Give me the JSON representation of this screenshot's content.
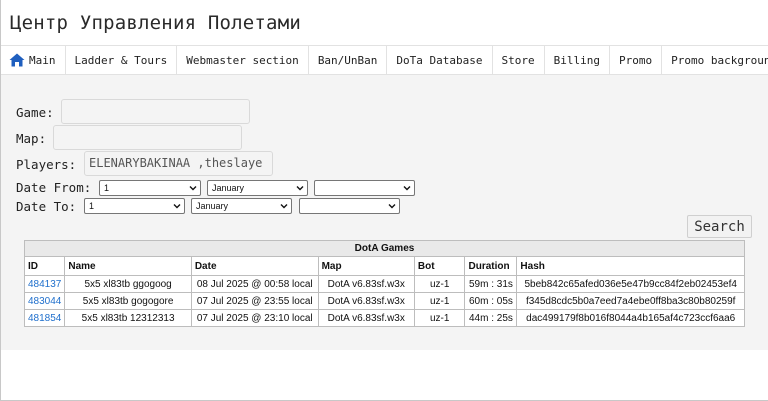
{
  "site": {
    "title": "Центр Управления Полетами"
  },
  "nav": {
    "items": [
      {
        "label": "Main",
        "icon": "home-icon"
      },
      {
        "label": "Ladder & Tours"
      },
      {
        "label": "Webmaster section"
      },
      {
        "label": "Ban/UnBan"
      },
      {
        "label": "DoTa Database"
      },
      {
        "label": "Store"
      },
      {
        "label": "Billing"
      },
      {
        "label": "Promo"
      },
      {
        "label": "Promo background"
      }
    ],
    "icon_color": "#1f5fbf"
  },
  "form": {
    "game": {
      "label": "Game:",
      "value": ""
    },
    "map": {
      "label": "Map:",
      "value": ""
    },
    "players": {
      "label": "Players:",
      "value": "ELENARYBAKINAA ,theslaye"
    },
    "date_from": {
      "label": "Date From:",
      "day": "1",
      "month": "January",
      "year": ""
    },
    "date_to": {
      "label": "Date To:",
      "day": "1",
      "month": "January",
      "year": ""
    },
    "search_label": "Search"
  },
  "table": {
    "caption": "DotA Games",
    "columns": [
      "ID",
      "Name",
      "Date",
      "Map",
      "Bot",
      "Duration",
      "Hash"
    ],
    "rows": [
      {
        "id": "484137",
        "name": "5x5 xl83tb ggogoog",
        "date": "08 Jul 2025 @ 00:58 local",
        "map": "DotA v6.83sf.w3x",
        "bot": "uz-1",
        "duration": "59m : 31s",
        "hash": "5beb842c65afed036e5e47b9cc84f2eb02453ef4"
      },
      {
        "id": "483044",
        "name": "5x5 xl83tb gogogore",
        "date": "07 Jul 2025 @ 23:55 local",
        "map": "DotA v6.83sf.w3x",
        "bot": "uz-1",
        "duration": "60m : 05s",
        "hash": "f345d8cdc5b0a7eed7a4ebe0ff8ba3c80b80259f"
      },
      {
        "id": "481854",
        "name": "5x5 xl83tb 12312313",
        "date": "07 Jul 2025 @ 23:10 local",
        "map": "DotA v6.83sf.w3x",
        "bot": "uz-1",
        "duration": "44m : 25s",
        "hash": "dac499179f8b016f8044a4b165af4c723ccf6aa6"
      }
    ],
    "link_color": "#1f6fcc"
  }
}
